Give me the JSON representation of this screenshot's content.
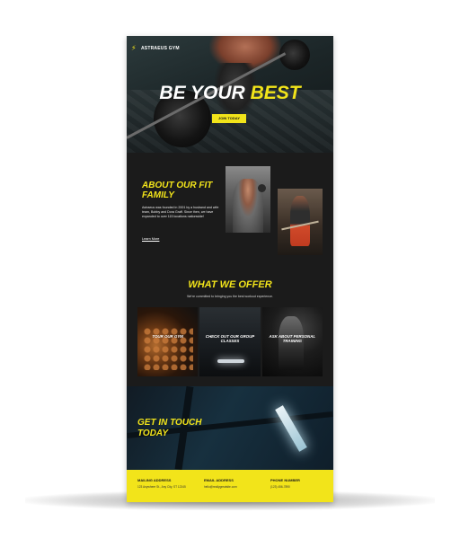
{
  "brand": {
    "name": "ASTRAEUS GYM",
    "accent": "#f2e41a"
  },
  "hero": {
    "title_white": "BE YOUR ",
    "title_yellow": "BEST",
    "cta_label": "JOIN TODAY"
  },
  "about": {
    "title": "ABOUT OUR FIT FAMILY",
    "body": "Astraeus was founded in 2001 by a husband and wife team, Bobby and Dora Graff. Since then, we have expanded to over 115 locations nationwide!",
    "link": "Learn More"
  },
  "offer": {
    "title": "WHAT WE OFFER",
    "subtitle": "We're committed to bringing you the best workout experience.",
    "cards": [
      {
        "label": "TOUR OUR GYM"
      },
      {
        "label": "CHECK OUT OUR GROUP CLASSES"
      },
      {
        "label": "ASK ABOUT PERSONAL TRAINING"
      }
    ]
  },
  "contact": {
    "title": "GET IN TOUCH TODAY",
    "columns": [
      {
        "heading": "MAILING ADDRESS",
        "value": "123 Anywhere St., Any City, ST 12345"
      },
      {
        "heading": "EMAIL ADDRESS",
        "value": "hello@reallygreatsite.com"
      },
      {
        "heading": "PHONE NUMBER",
        "value": "(123) 456-7890"
      }
    ]
  },
  "icons": {
    "logo": "lightning-bolt-icon"
  }
}
